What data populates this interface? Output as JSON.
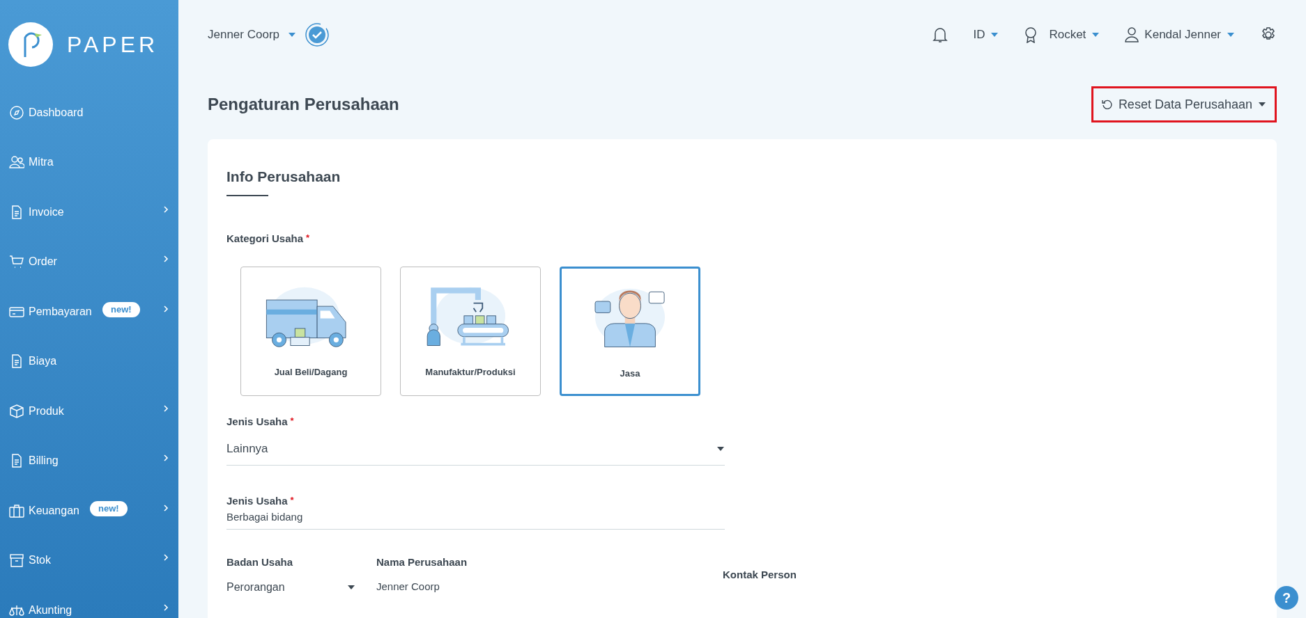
{
  "logo": {
    "text": "PAPER"
  },
  "sidebar": {
    "items": [
      {
        "label": "Dashboard",
        "has_children": false
      },
      {
        "label": "Mitra",
        "has_children": false
      },
      {
        "label": "Invoice",
        "has_children": true
      },
      {
        "label": "Order",
        "has_children": true
      },
      {
        "label": "Pembayaran",
        "badge": "new!",
        "has_children": true
      },
      {
        "label": "Biaya",
        "has_children": false
      },
      {
        "label": "Produk",
        "has_children": true
      },
      {
        "label": "Billing",
        "has_children": true
      },
      {
        "label": "Keuangan",
        "badge": "new!",
        "has_children": true
      },
      {
        "label": "Stok",
        "has_children": true
      },
      {
        "label": "Akunting",
        "has_children": true
      }
    ]
  },
  "header": {
    "company": "Jenner Coorp",
    "language": "ID",
    "plan": "Rocket",
    "user": "Kendal Jenner"
  },
  "page": {
    "title": "Pengaturan Perusahaan",
    "reset_button": "Reset Data Perusahaan"
  },
  "card": {
    "title": "Info Perusahaan",
    "category": {
      "label": "Kategori Usaha",
      "required_mark": "*",
      "options": [
        {
          "label": "Jual Beli/Dagang",
          "kind": "truck",
          "selected": false
        },
        {
          "label": "Manufaktur/Produksi",
          "kind": "factory",
          "selected": false
        },
        {
          "label": "Jasa",
          "kind": "person",
          "selected": true
        }
      ]
    },
    "business_type": {
      "label": "Jenis Usaha",
      "required_mark": "*",
      "value": "Lainnya"
    },
    "business_field": {
      "label": "Jenis Usaha",
      "required_mark": "*",
      "value": "Berbagai bidang"
    },
    "entity": {
      "label": "Badan Usaha",
      "value": "Perorangan"
    },
    "company_name": {
      "label": "Nama Perusahaan",
      "value": "Jenner Coorp"
    },
    "contact": {
      "label": "Kontak Person"
    }
  },
  "help_button": "?"
}
